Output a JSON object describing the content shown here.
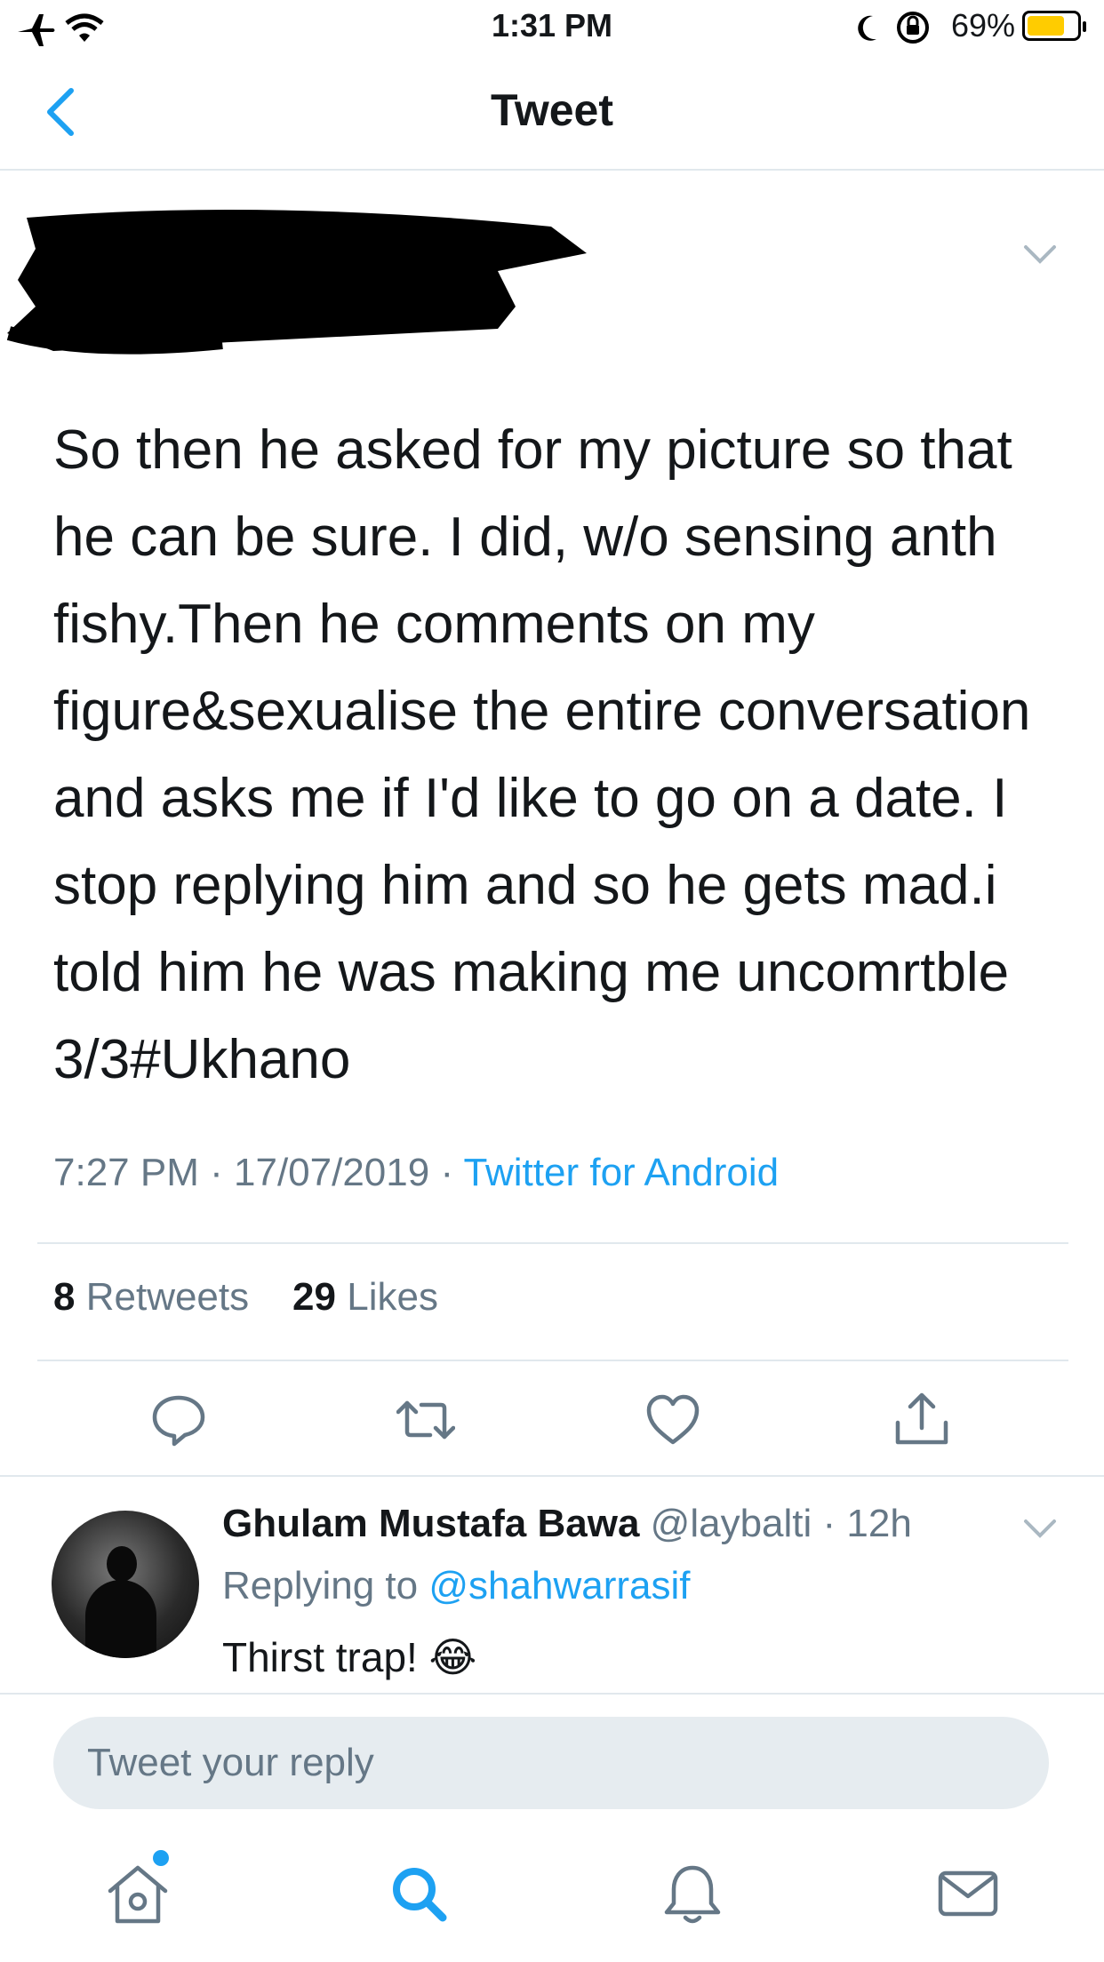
{
  "status_bar": {
    "time": "1:31 PM",
    "battery_percent": "69%",
    "battery_level": 0.69,
    "icons": [
      "airplane-icon",
      "wifi-icon",
      "moon-icon",
      "rotation-lock-icon",
      "battery-icon"
    ]
  },
  "nav": {
    "title": "Tweet",
    "back_icon": "chevron-left-icon"
  },
  "tweet": {
    "text": "So then he asked for my picture so that\nhe can be sure. I did, w/o sensing anth\nfishy.Then he comments on my\nfigure&sexualise the entire conversation\nand asks me if I'd like to go on a date. I\nstop replying him and so he gets mad.i\ntold him he was making me uncomrtble\n3/3#Ukhano",
    "time": "7:27 PM",
    "date": "17/07/2019",
    "source": "Twitter for Android",
    "retweets_count": "8",
    "retweets_label": "Retweets",
    "likes_count": "29",
    "likes_label": "Likes"
  },
  "actions": [
    "reply-icon",
    "retweet-icon",
    "like-icon",
    "share-icon"
  ],
  "reply": {
    "name": "Ghulam Mustafa Bawa",
    "handle": "@laybalti",
    "time": "12h",
    "replying_label": "Replying to",
    "replying_handle": "@shahwarrasif",
    "text": "Thirst trap!",
    "emoji": "😂"
  },
  "compose": {
    "placeholder": "Tweet your reply"
  },
  "tab_bar": [
    "home-icon",
    "search-icon",
    "notifications-icon",
    "messages-icon"
  ],
  "colors": {
    "accent": "#1da1f2",
    "secondary_text": "#657786",
    "battery_fill": "#ffcc00"
  }
}
